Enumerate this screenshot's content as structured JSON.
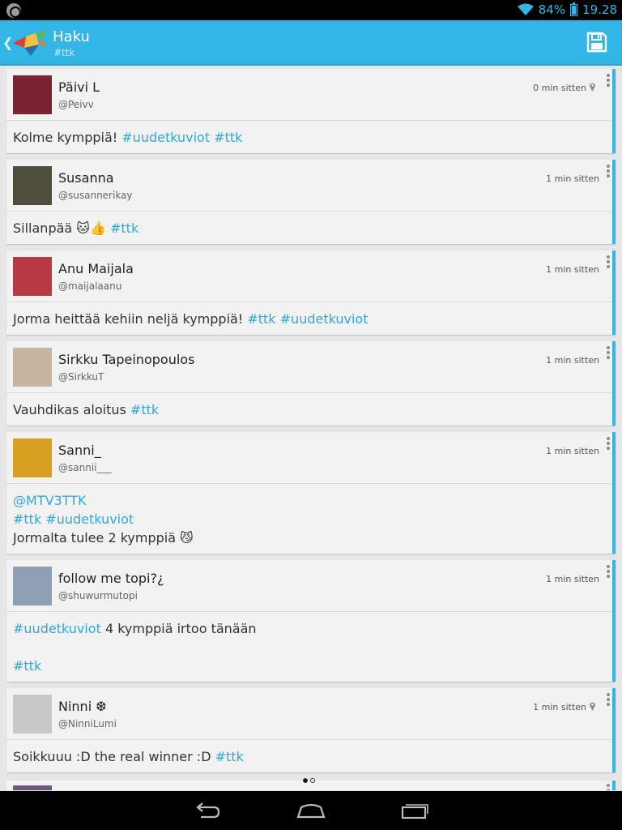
{
  "status_bar": {
    "battery": "84%",
    "time": "19.28"
  },
  "header": {
    "back_icon": "chevron-left-icon",
    "title": "Haku",
    "subtitle": "#ttk",
    "save_icon": "save-icon",
    "accent": "#33b5e5"
  },
  "posts": [
    {
      "name": "Päivi L",
      "handle": "@Peivv",
      "time": "0 min sitten",
      "body": [
        [
          {
            "t": "Kolme kymppiä! ",
            "tag": false
          },
          {
            "t": "#uudetkuviot",
            "tag": true
          },
          {
            "t": " ",
            "tag": false
          },
          {
            "t": "#ttk",
            "tag": true
          }
        ]
      ]
    },
    {
      "name": "Susanna",
      "handle": "@susannerikay",
      "time": "1 min sitten",
      "body": [
        [
          {
            "t": "Sillanpää 🐱👍 ",
            "tag": false
          },
          {
            "t": "#ttk",
            "tag": true
          }
        ]
      ]
    },
    {
      "name": "Anu Maijala",
      "handle": "@maijalaanu",
      "time": "1 min sitten",
      "body": [
        [
          {
            "t": "Jorma heittää kehiin neljä kymppiä! ",
            "tag": false
          },
          {
            "t": "#ttk",
            "tag": true
          },
          {
            "t": " ",
            "tag": false
          },
          {
            "t": "#uudetkuviot",
            "tag": true
          }
        ]
      ]
    },
    {
      "name": "Sirkku Tapeinopoulos",
      "handle": "@SirkkuT",
      "time": "1 min sitten",
      "body": [
        [
          {
            "t": "Vauhdikas aloitus ",
            "tag": false
          },
          {
            "t": "#ttk",
            "tag": true
          }
        ]
      ]
    },
    {
      "name": "Sanni_",
      "handle": "@sannii___",
      "time": "1 min sitten",
      "body": [
        [
          {
            "t": "@MTV3TTK",
            "tag": true
          }
        ],
        [
          {
            "t": "#ttk",
            "tag": true
          },
          {
            "t": " ",
            "tag": false
          },
          {
            "t": "#uudetkuviot",
            "tag": true
          }
        ],
        [
          {
            "t": "Jormalta tulee 2 kymppiä 😼",
            "tag": false
          }
        ]
      ]
    },
    {
      "name": "follow me topi?¿",
      "handle": "@shuwurmutopi",
      "time": "1 min sitten",
      "body": [
        [
          {
            "t": "#uudetkuviot",
            "tag": true
          },
          {
            "t": " 4 kymppiä irtoo tänään",
            "tag": false
          }
        ],
        [],
        [
          {
            "t": "#ttk",
            "tag": true
          }
        ]
      ]
    },
    {
      "name": "Ninni ❆",
      "handle": "@NinniLumi",
      "time": "1 min sitten",
      "body": [
        [
          {
            "t": "Soikkuuu :D the real winner :D ",
            "tag": false
          },
          {
            "t": "#ttk",
            "tag": true
          }
        ]
      ]
    }
  ],
  "pin_posts": [
    0,
    6
  ],
  "avatar_colors": [
    "#7a2434",
    "#4e4e3c",
    "#b83a44",
    "#c9b6a0",
    "#d9a020",
    "#8fa0b4",
    "#c8c8c8"
  ],
  "navbar": {
    "back_icon": "back-icon",
    "home_icon": "home-icon",
    "recents_icon": "recent-apps-icon"
  }
}
